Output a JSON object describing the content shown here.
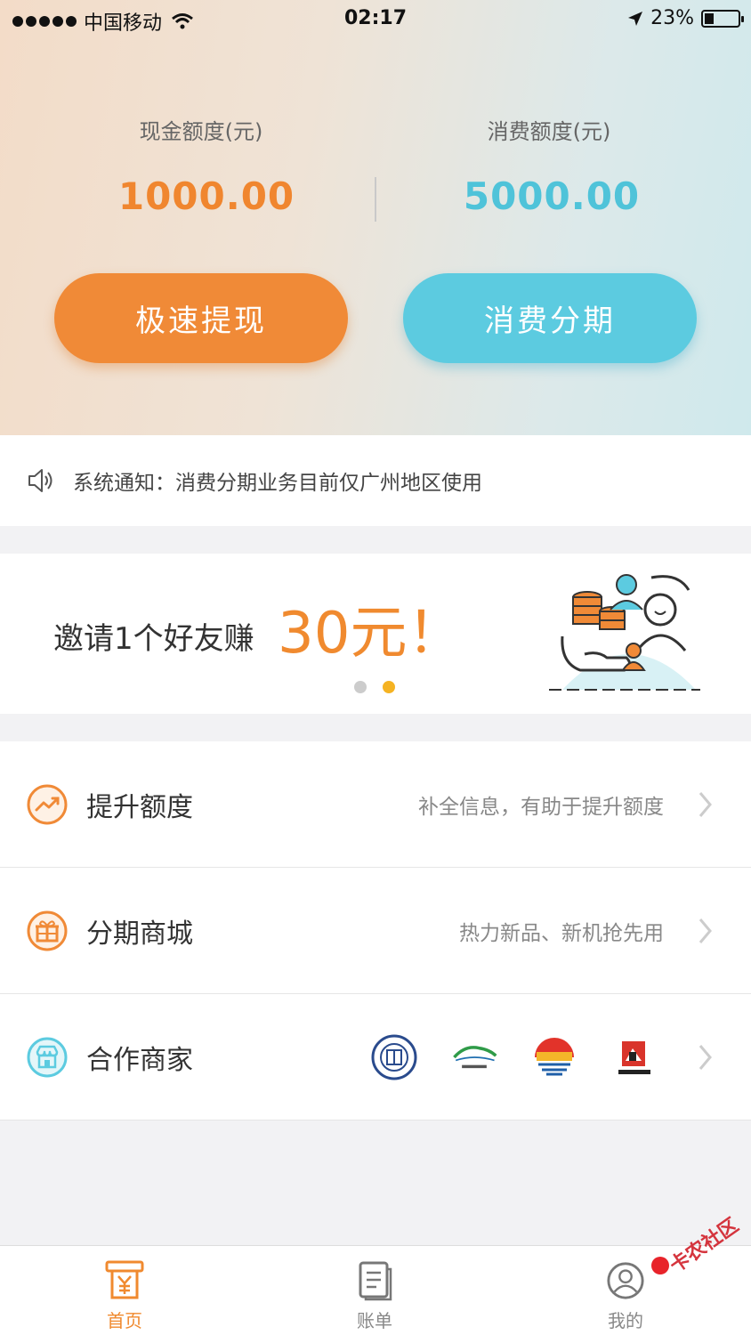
{
  "status_bar": {
    "carrier": "中国移动",
    "time": "02:17",
    "battery": "23%"
  },
  "quota": {
    "cash_label": "现金额度(元)",
    "cash_value": "1000.00",
    "consume_label": "消费额度(元)",
    "consume_value": "5000.00"
  },
  "actions": {
    "withdraw": "极速提现",
    "installment": "消费分期"
  },
  "notice": {
    "text": "系统通知：消费分期业务目前仅广州地区使用"
  },
  "banner": {
    "text": "邀请1个好友赚",
    "highlight": "30元！",
    "active_slide": 2,
    "slide_count": 2
  },
  "list": [
    {
      "title": "提升额度",
      "desc": "补全信息，有助于提升额度",
      "icon": "trend-up-icon"
    },
    {
      "title": "分期商城",
      "desc": "热力新品、新机抢先用",
      "icon": "gift-icon"
    },
    {
      "title": "合作商家",
      "desc": "",
      "icon": "store-icon"
    }
  ],
  "tabs": [
    {
      "label": "首页",
      "icon": "yuan-atm-icon",
      "active": true
    },
    {
      "label": "账单",
      "icon": "bill-icon",
      "active": false
    },
    {
      "label": "我的",
      "icon": "user-icon",
      "active": false
    }
  ],
  "watermark": "卡农社区",
  "colors": {
    "orange": "#f08a37",
    "cyan": "#5ccbe0",
    "badge_red": "#e8232a"
  }
}
